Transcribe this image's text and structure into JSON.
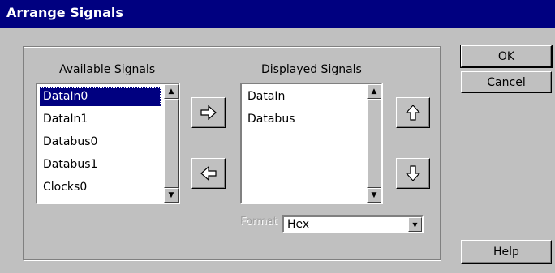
{
  "window": {
    "title": "Arrange Signals"
  },
  "available": {
    "label": "Available Signals",
    "items": [
      "DataIn0",
      "DataIn1",
      "Databus0",
      "Databus1",
      "Clocks0"
    ],
    "selected": "DataIn0"
  },
  "displayed": {
    "label": "Displayed Signals",
    "items": [
      "DataIn",
      "Databus"
    ]
  },
  "format": {
    "label": "Format",
    "value": "Hex"
  },
  "buttons": {
    "ok": "OK",
    "cancel": "Cancel",
    "help": "Help"
  },
  "icons": {
    "add": "arrow-right-icon",
    "remove": "arrow-left-icon",
    "move_up": "arrow-up-icon",
    "move_down": "arrow-down-icon"
  },
  "colors": {
    "titlebar": "#000080",
    "selection": "#000080",
    "face": "#c0c0c0"
  }
}
